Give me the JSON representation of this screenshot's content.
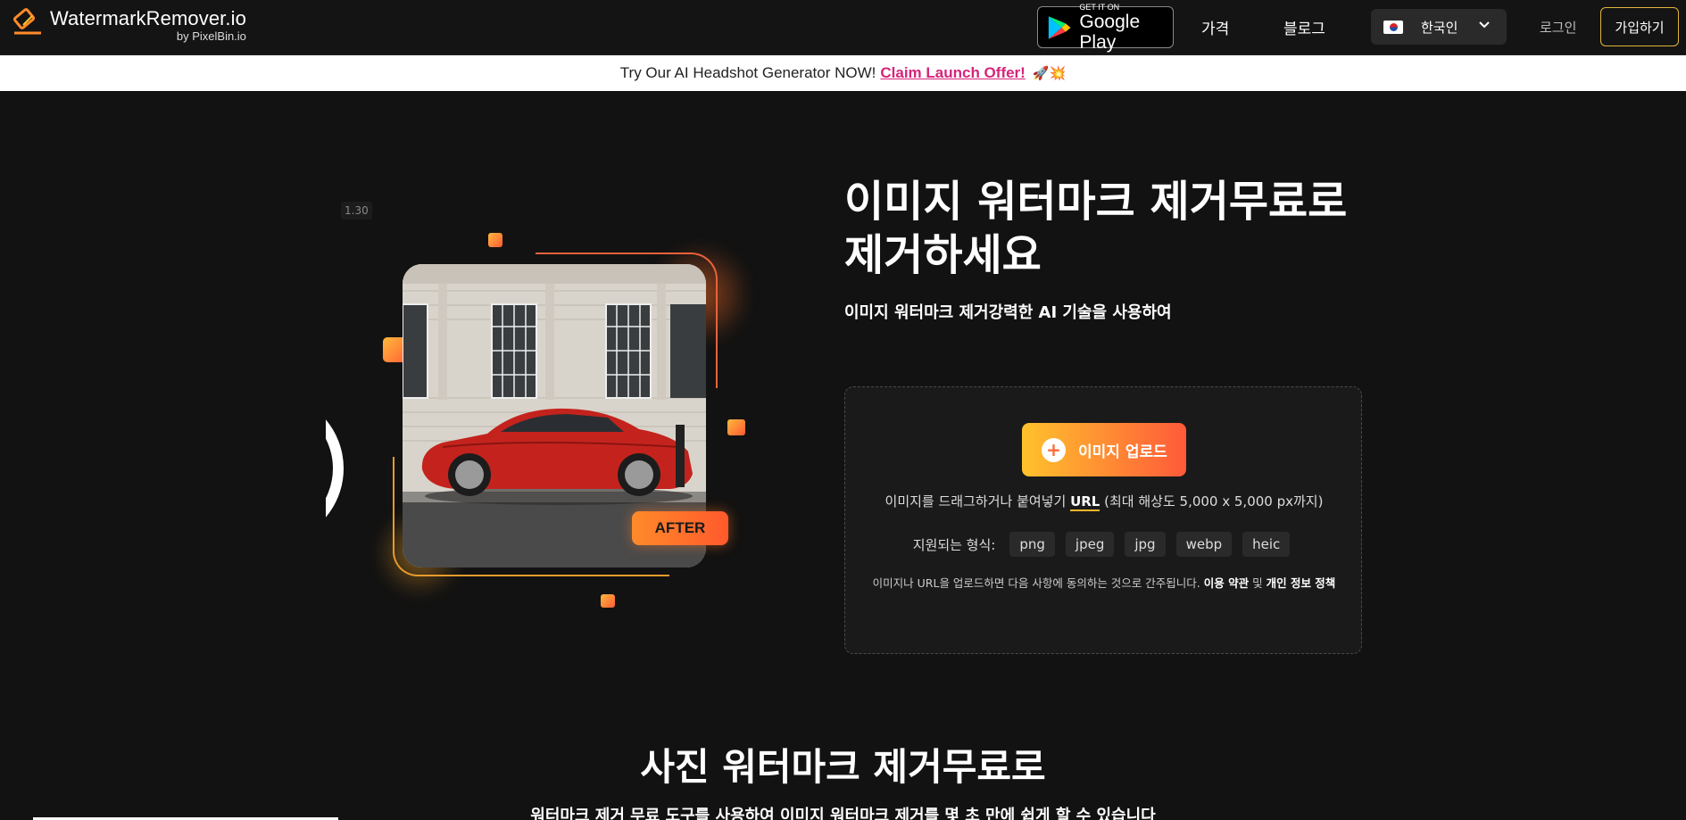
{
  "nav": {
    "logo_title": "WatermarkRemover.io",
    "logo_sub": "by PixelBin.io",
    "gplay_small": "GET IT ON",
    "gplay_big": "Google Play",
    "pricing": "가격",
    "blog": "블로그",
    "language": "한국인",
    "login": "로그인",
    "signup": "가입하기"
  },
  "promo": {
    "text": "Try Our AI Headshot Generator NOW!",
    "link": "Claim Launch Offer!",
    "emoji": "🚀💥"
  },
  "hero": {
    "version_badge": "1.30",
    "after_badge": "AFTER",
    "title": "이미지 워터마크 제거무료로 제거하세요",
    "subtitle": "이미지 워터마크 제거강력한 AI 기술을 사용하여",
    "upload_button": "이미지 업로드",
    "drag_text_before": "이미지를 드래그하거나 붙여넣기",
    "url_link": "URL",
    "drag_text_after": "(최대 해상도 5,000 x 5,000 px까지)",
    "formats_label": "지원되는 형식:",
    "formats": [
      "png",
      "jpeg",
      "jpg",
      "webp",
      "heic"
    ],
    "terms_before": "이미지나 URL을 업로드하면 다음 사항에 동의하는 것으로 간주됩니다.",
    "terms_link": "이용 약관",
    "terms_and": "및",
    "privacy_link": "개인 정보 정책"
  },
  "section2": {
    "title": "사진 워터마크 제거무료로",
    "subtitle": "워터마크 제거 무료 도구를 사용하여 이미지 워터마크 제거를 몇 초 만에 쉽게 할 수 있습니다"
  },
  "colors": {
    "accent_start": "#ffc22c",
    "accent_end": "#ff5a3a",
    "promo_link": "#d6247a",
    "signup_border": "#e2b53a"
  }
}
